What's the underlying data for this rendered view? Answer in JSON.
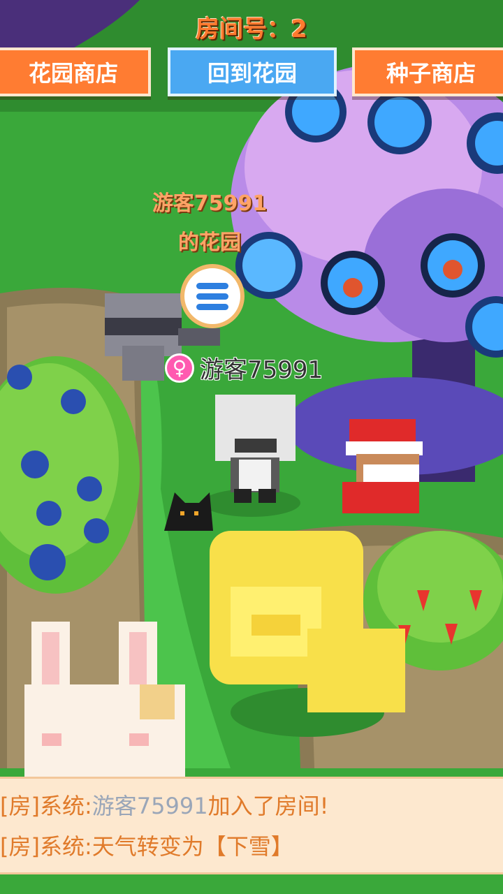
{
  "room": {
    "title": "房间号：2"
  },
  "top_buttons": {
    "garden_shop": "花园商店",
    "back_to_garden": "回到花园",
    "seed_shop": "种子商店"
  },
  "garden_owner_label": {
    "line1": "游客75991",
    "line2": "的花园"
  },
  "player": {
    "name": "游客75991",
    "gender_symbol": "♀"
  },
  "chat": {
    "messages": [
      {
        "channel": "[房]",
        "sender": "系统:",
        "player": "游客75991",
        "text": "加入了房间!"
      },
      {
        "channel": "[房]",
        "sender": "系统:",
        "player": "",
        "text": "天气转变为【下雪】"
      }
    ]
  },
  "colors": {
    "grass": "#3aa83a",
    "button_orange": "#ff7c32",
    "button_blue": "#4aa8f2",
    "chat_bg": "#fde8cf",
    "chat_text": "#e07a2a"
  },
  "icons": [
    "menu-icon",
    "female-icon",
    "raccoon-sprite",
    "bear-avatar-sprite",
    "santa-monkey-sprite",
    "black-cat-sprite",
    "golden-lion-sprite",
    "bunny-sprite",
    "blueberry-bush",
    "strawberry-bush",
    "crystal-tree"
  ]
}
